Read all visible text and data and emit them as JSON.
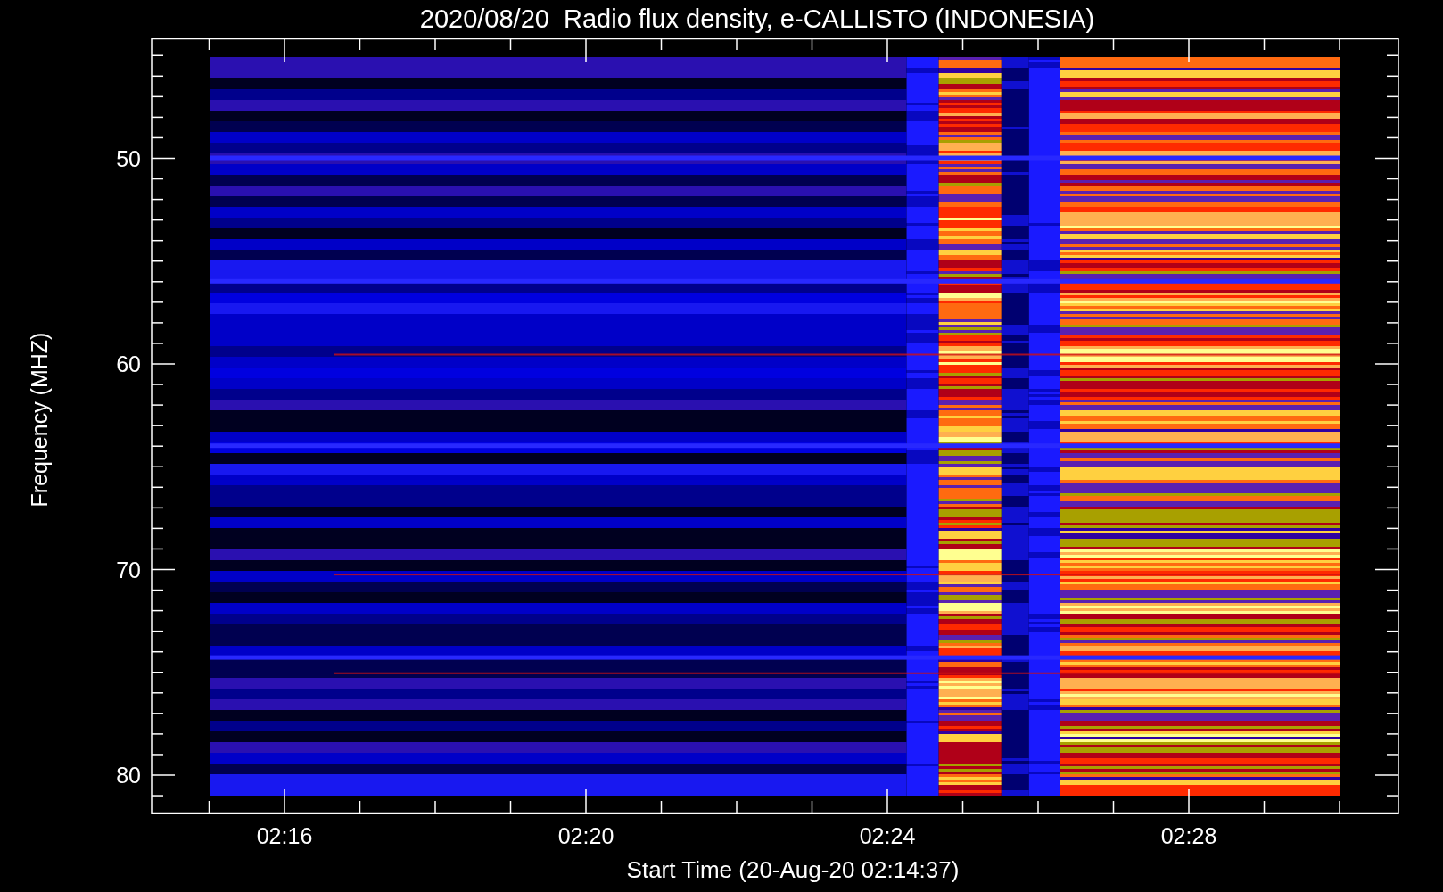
{
  "plot": {
    "title": "2020/08/20  Radio flux density, e-CALLISTO (INDONESIA)",
    "xlabel": "Start Time (20-Aug-20 02:14:37)",
    "ylabel": "Frequency (MHZ)",
    "y_tick_labels": [
      "50",
      "60",
      "70",
      "80"
    ],
    "x_tick_labels": [
      "02:16",
      "02:20",
      "02:24",
      "02:28"
    ]
  }
}
